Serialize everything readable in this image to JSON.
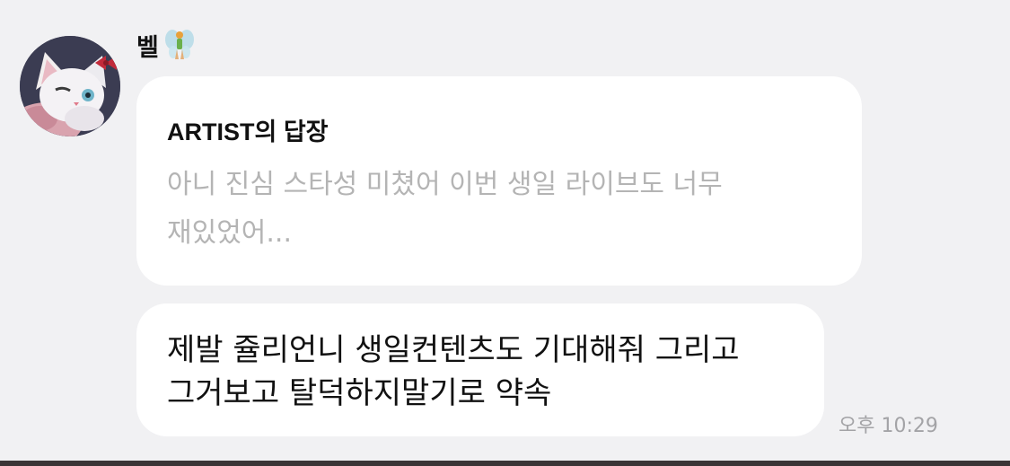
{
  "sender": {
    "name": "벨",
    "badge_icon": "fairy-icon"
  },
  "reply": {
    "title": "ARTIST의 답장",
    "quote": "아니 진심 스타성 미쳤어 이번 생일 라이브도 너무 재있었어..."
  },
  "message": {
    "text": "제발 쥴리언니 생일컨텐츠도 기대해줘 그리고 그거보고 탈덕하지말기로 약속",
    "time": "오후 10:29"
  },
  "colors": {
    "background": "#f1f1f3",
    "bubble": "#ffffff",
    "quote_text": "#b4b4b4",
    "time_text": "#a3a3a6"
  }
}
